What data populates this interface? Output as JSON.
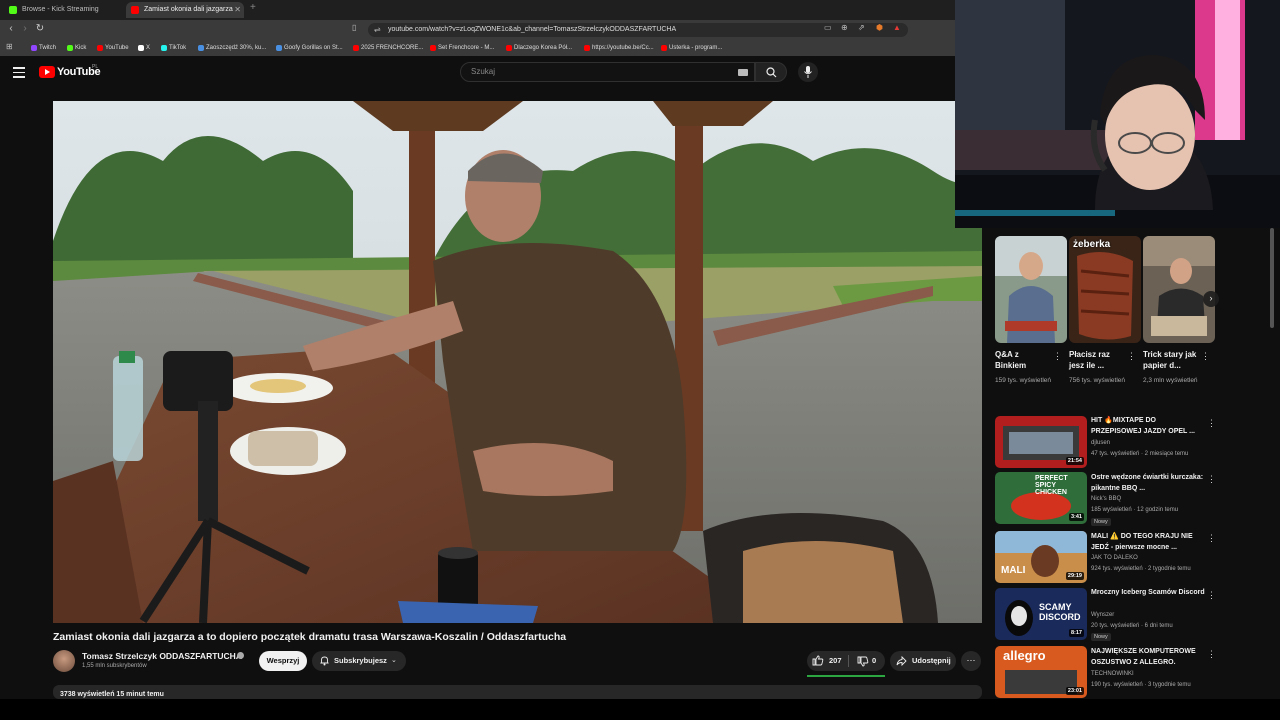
{
  "browser": {
    "tabs": [
      {
        "label": "Browse - Kick Streaming",
        "color": "#53fc18"
      },
      {
        "label": "Zamiast okonia dali jazgarza",
        "color": "#ff0000"
      }
    ],
    "url": "youtube.com/watch?v=zLoqZWONE1c&ab_channel=TomaszStrzelczykODDASZFARTUCHA",
    "bookmarks": [
      {
        "label": "Twitch",
        "color": "#9146ff"
      },
      {
        "label": "Kick",
        "color": "#53fc18"
      },
      {
        "label": "YouTube",
        "color": "#ff0000"
      },
      {
        "label": "X",
        "color": "#ffffff"
      },
      {
        "label": "TikTok",
        "color": "#25f4ee"
      },
      {
        "label": "Zaoszczędź 30%, ku...",
        "color": "#4a90e2"
      },
      {
        "label": "Goofy Gorillas on St...",
        "color": "#4a90e2"
      },
      {
        "label": "2025 FRENCHCORE...",
        "color": "#ff0000"
      },
      {
        "label": "Set Frenchcore - M...",
        "color": "#ff0000"
      },
      {
        "label": "Dlaczego Korea Pół...",
        "color": "#ff0000"
      },
      {
        "label": "https://youtube.be/Cc...",
        "color": "#ff0000"
      },
      {
        "label": "Usterka - program...",
        "color": "#ff0000"
      }
    ]
  },
  "youtube": {
    "logo_text": "YouTube",
    "region": "PL",
    "search_placeholder": "Szukaj"
  },
  "video": {
    "title": "Zamiast okonia dali jazgarza a to dopiero początek dramatu trasa Warszawa-Koszalin / Oddaszfartucha",
    "channel_name": "Tomasz Strzelczyk ODDASZFARTUCHA",
    "subscribers": "1,55 mln subskrybentów",
    "join_label": "Wesprzyj",
    "subscribe_label": "Subskrybujesz",
    "likes": "207",
    "dislikes": "0",
    "like_ratio": 1.0,
    "share_label": "Udostępnij",
    "more_label": "⋯",
    "description_header": "3738 wyświetleń  15 minut temu"
  },
  "shorts": [
    {
      "title": "Q&A z Binkiem",
      "views": "159 tys. wyświetleń"
    },
    {
      "title": "Płacisz raz jesz ile ...",
      "views": "756 tys. wyświetleń",
      "overlay": "żeberka"
    },
    {
      "title": "Trick stary jak papier d...",
      "views": "2,3 mln wyświetleń"
    }
  ],
  "related": [
    {
      "title": "HIT 🔥MIXTAPE DO PRZEPISOWEJ JAZDY OPEL ...",
      "channel": "djlusen",
      "meta": "47 tys. wyświetleń · 2 miesiące temu",
      "duration": "21:54",
      "badge": ""
    },
    {
      "title": "Ostre wędzone ćwiartki kurczaka: pikantne BBQ ...",
      "channel": "Nick's BBQ",
      "meta": "185 wyświetleń · 12 godzin temu",
      "duration": "3:41",
      "badge": "Nowy"
    },
    {
      "title": "MALI ⚠️ DO TEGO KRAJU NIE JEDŹ - pierwsze mocne ...",
      "channel": "JAK TO DALEKO",
      "meta": "924 tys. wyświetleń · 2 tygodnie temu",
      "duration": "29:19",
      "badge": ""
    },
    {
      "title": "Mroczny Iceberg Scamów Discord",
      "channel": "Wynszer",
      "meta": "20 tys. wyświetleń · 6 dni temu",
      "duration": "8:17",
      "badge": "Nowy"
    },
    {
      "title": "NAJWIĘKSZE KOMPUTEROWE OSZUSTWO Z ALLEGRO.",
      "channel": "TECHNOWINKI",
      "meta": "190 tys. wyświetleń · 3 tygodnie temu",
      "duration": "23:01",
      "badge": ""
    }
  ]
}
